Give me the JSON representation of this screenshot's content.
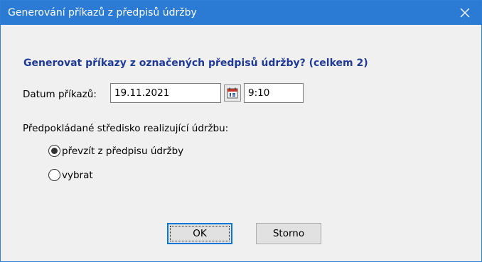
{
  "window": {
    "title": "Generování příkazů z předpisů údržby"
  },
  "dialog": {
    "question": "Generovat příkazy z označených předpisů údržby?  (celkem 2)",
    "date_label": "Datum příkazů:",
    "date_value": "19.11.2021",
    "time_value": "9:10",
    "center_label": "Předpokládané středisko realizující údržbu:",
    "options": [
      {
        "label": "převzít z předpisu údržby",
        "selected": true
      },
      {
        "label": "vybrat",
        "selected": false
      }
    ]
  },
  "buttons": {
    "ok_label": "OK",
    "cancel_label": "Storno"
  },
  "colors": {
    "titlebar": "#2b7bd4",
    "question_text": "#1f3a93",
    "default_button_border": "#0078d7"
  },
  "icons": {
    "close": "close-icon",
    "calendar": "calendar-icon"
  }
}
